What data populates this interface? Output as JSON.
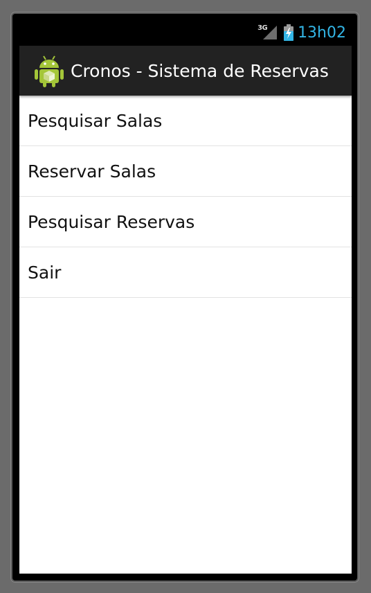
{
  "status_bar": {
    "network_type": "3G",
    "time": "13h02",
    "icons": [
      "signal-icon",
      "battery-charging-icon"
    ]
  },
  "action_bar": {
    "app_icon": "android-app-icon",
    "title": "Cronos - Sistema de Reservas"
  },
  "menu": {
    "items": [
      {
        "label": "Pesquisar Salas"
      },
      {
        "label": "Reservar Salas"
      },
      {
        "label": "Pesquisar Reservas"
      },
      {
        "label": "Sair"
      }
    ]
  },
  "colors": {
    "clock": "#33b5e5",
    "action_bar_bg": "#222222",
    "android_green": "#a4c639"
  }
}
